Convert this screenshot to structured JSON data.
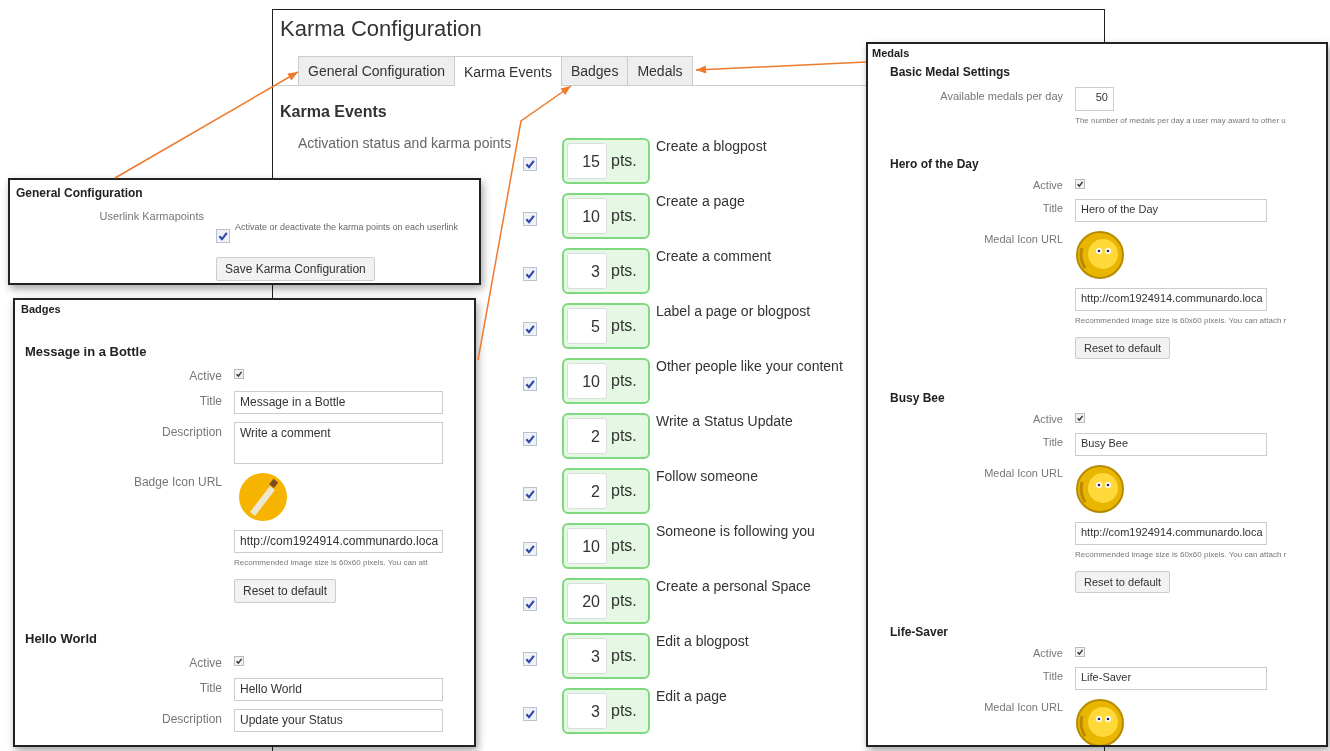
{
  "window": {
    "title": "Karma Configuration",
    "tabs": [
      {
        "label": "General Configuration",
        "selected": false
      },
      {
        "label": "Karma Events",
        "selected": true
      },
      {
        "label": "Badges",
        "selected": false
      },
      {
        "label": "Medals",
        "selected": false
      }
    ],
    "heading": "Karma Events",
    "section_label": "Activation status and karma points",
    "events": [
      {
        "checked": true,
        "points": "15",
        "unit": "pts.",
        "label": "Create a blogpost"
      },
      {
        "checked": true,
        "points": "10",
        "unit": "pts.",
        "label": "Create a page"
      },
      {
        "checked": true,
        "points": "3",
        "unit": "pts.",
        "label": "Create a comment"
      },
      {
        "checked": true,
        "points": "5",
        "unit": "pts.",
        "label": "Label a page or blogpost"
      },
      {
        "checked": true,
        "points": "10",
        "unit": "pts.",
        "label": "Other people like your content"
      },
      {
        "checked": true,
        "points": "2",
        "unit": "pts.",
        "label": "Write a Status Update"
      },
      {
        "checked": true,
        "points": "2",
        "unit": "pts.",
        "label": "Follow someone"
      },
      {
        "checked": true,
        "points": "10",
        "unit": "pts.",
        "label": "Someone is following you"
      },
      {
        "checked": true,
        "points": "20",
        "unit": "pts.",
        "label": "Create a personal Space"
      },
      {
        "checked": true,
        "points": "3",
        "unit": "pts.",
        "label": "Edit a blogpost"
      },
      {
        "checked": true,
        "points": "3",
        "unit": "pts.",
        "label": "Edit a page"
      }
    ]
  },
  "general_panel": {
    "title": "General Configuration",
    "sections": [
      {
        "rows": [
          {
            "kind": "checkbox",
            "label": "Userlink Karmapoints",
            "checked": true,
            "note": "Activate or deactivate the karma points on each userlink"
          },
          {
            "kind": "button",
            "label": "Save Karma Configuration"
          }
        ]
      }
    ]
  },
  "badges_panel": {
    "title": "Badges",
    "sections": [
      {
        "heading": "Message in a Bottle",
        "rows": [
          {
            "kind": "checkbox",
            "label": "Active",
            "checked": true
          },
          {
            "kind": "text",
            "label": "Title",
            "value": "Message in a Bottle"
          },
          {
            "kind": "textarea",
            "label": "Description",
            "value": "Write a comment"
          },
          {
            "kind": "image",
            "label": "Badge Icon URL"
          },
          {
            "kind": "text",
            "value": "http://com1924914.communardo.loca"
          },
          {
            "kind": "help",
            "value": "Recommended image size is 60x60 pixels. You can att"
          },
          {
            "kind": "button",
            "label": "Reset to default"
          }
        ]
      },
      {
        "heading": "Hello World",
        "rows": [
          {
            "kind": "checkbox",
            "label": "Active",
            "checked": true
          },
          {
            "kind": "text",
            "label": "Title",
            "value": "Hello World"
          },
          {
            "kind": "text",
            "label": "Description",
            "value": "Update your Status"
          }
        ]
      }
    ]
  },
  "medals_panel": {
    "title": "Medals",
    "sections": [
      {
        "heading": "Basic Medal Settings",
        "rows": [
          {
            "kind": "number",
            "label": "Available medals per day",
            "value": "50"
          },
          {
            "kind": "help",
            "value": "The number of medals per day a user may award to other u"
          }
        ]
      },
      {
        "heading": "Hero of the Day",
        "rows": [
          {
            "kind": "checkbox",
            "label": "Active",
            "checked": true
          },
          {
            "kind": "text",
            "label": "Title",
            "value": "Hero of the Day"
          },
          {
            "kind": "image",
            "label": "Medal Icon URL"
          },
          {
            "kind": "text",
            "value": "http://com1924914.communardo.loca"
          },
          {
            "kind": "help",
            "value": "Recommended image size is 60x60 pixels. You can attach r"
          },
          {
            "kind": "button",
            "label": "Reset to default"
          }
        ]
      },
      {
        "heading": "Busy Bee",
        "rows": [
          {
            "kind": "checkbox",
            "label": "Active",
            "checked": true
          },
          {
            "kind": "text",
            "label": "Title",
            "value": "Busy Bee"
          },
          {
            "kind": "image",
            "label": "Medal Icon URL"
          },
          {
            "kind": "text",
            "value": "http://com1924914.communardo.loca"
          },
          {
            "kind": "help",
            "value": "Recommended image size is 60x60 pixels. You can attach r"
          },
          {
            "kind": "button",
            "label": "Reset to default"
          }
        ]
      },
      {
        "heading": "Life-Saver",
        "rows": [
          {
            "kind": "checkbox",
            "label": "Active",
            "checked": true
          },
          {
            "kind": "text",
            "label": "Title",
            "value": "Life-Saver"
          },
          {
            "kind": "image",
            "label": "Medal Icon URL"
          }
        ]
      }
    ]
  }
}
